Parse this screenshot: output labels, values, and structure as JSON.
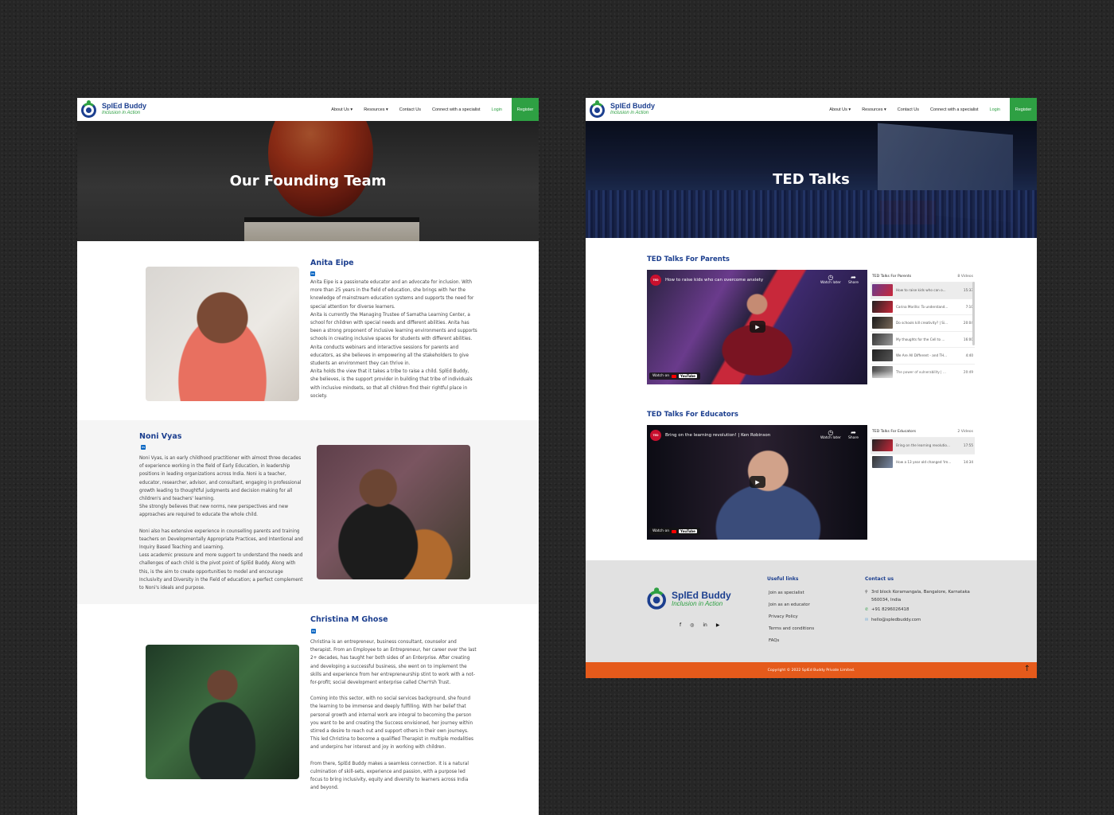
{
  "brand": {
    "name": "SplEd Buddy",
    "tagline": "Inclusion in Action"
  },
  "nav": {
    "about": "About Us ▾",
    "resources": "Resources ▾",
    "contact": "Contact Us",
    "connect": "Connect with a specialist",
    "login": "Login",
    "register": "Register"
  },
  "team_page": {
    "hero_title": "Our Founding Team",
    "members": [
      {
        "name": "Anita Eipe",
        "paragraphs": [
          "Anita Eipe is a passionate educator and an advocate for inclusion. With more than 25 years in the field of education, she brings with her the knowledge of mainstream education systems and supports the need for special attention for diverse learners.",
          "Anita is currently the Managing Trustee of Samatha Learning Center, a school for children with special needs and different abilities. Anita has been a strong proponent of inclusive learning environments and supports schools in creating inclusive spaces for students with different abilities. Anita conducts webinars and interactive sessions for parents and educators, as she believes in empowering all the stakeholders to give students an environment they can thrive in.",
          "Anita holds the view that it takes a tribe to raise a child. SplEd Buddy, she believes, is the support provider in building that tribe of individuals with inclusive mindsets, so that all children find their rightful place in society."
        ]
      },
      {
        "name": "Noni Vyas",
        "paragraphs": [
          "Noni Vyas, is an early childhood practitioner with almost three decades of experience working in the field of Early Education, in leadership positions in leading organizations across India. Noni is a teacher, educator, researcher, advisor, and consultant, engaging in professional growth leading to thoughtful judgments and decision making for all children's and teachers' learning.",
          "She strongly believes that new norms, new perspectives and new approaches are required to educate the whole child.",
          "Noni also has extensive experience in counselling parents and training teachers on Developmentally Appropriate Practices, and Intentional and Inquiry Based Teaching and Learning.",
          "Less academic pressure and more support to understand the needs and challenges of each child is the pivot point of SplEd Buddy. Along with this, is the aim to create opportunities to model and encourage Inclusivity and Diversity in the Field of education; a perfect complement to Noni's ideals and purpose."
        ]
      },
      {
        "name": "Christina M Ghose",
        "paragraphs": [
          "Christina is an entrepreneur, business consultant, counselor and therapist. From an Employee to an Entrepreneur, her career over the last 2+ decades, has taught her both sides of an Enterprise. After creating and developing a successful business, she went on to implement the skills and experience from her entrepreneurship stint to work with a not-for-profit; social development enterprise called CherYsh Trust.",
          "Coming into this sector, with no social services background, she found the learning to be immense and deeply fulfilling. With her belief that personal growth and internal work are integral to becoming the person you want to be and creating the Success envisioned, her journey within stirred a desire to reach out and support others in their own journeys. This led Christina to become a qualified Therapist in multiple modalities and underpins her interest and joy in working with children.",
          "From there, SplEd Buddy makes a seamless connection. It is a natural culmination of skill-sets, experience and passion, with a purpose led focus to bring inclusivity, equity and diversity to learners across India and beyond."
        ]
      }
    ]
  },
  "ted_page": {
    "hero_title": "TED Talks",
    "sections": [
      {
        "title": "TED Talks For Parents",
        "video_title": "How to raise kids who can overcome anxiety",
        "watch_later": "Watch later",
        "share": "Share",
        "watch_on": "Watch on",
        "youtube": "YouTube",
        "playlist_title": "TED Talks For Parents",
        "playlist_count": "8 Videos",
        "items": [
          {
            "title": "How to raise kids who can o...",
            "duration": "15:33"
          },
          {
            "title": "Carina Morillo: To understand...",
            "duration": "7:10"
          },
          {
            "title": "Do schools kill creativity? | Si...",
            "duration": "20:04"
          },
          {
            "title": "My thoughts for the Cell to ...",
            "duration": "16:00"
          },
          {
            "title": "We Are All Different - and TH...",
            "duration": "4:40"
          },
          {
            "title": "The power of vulnerability | ...",
            "duration": "20:49"
          }
        ]
      },
      {
        "title": "TED Talks For Educators",
        "video_title": "Bring on the learning revolution! | Ken Robinson",
        "watch_later": "Watch later",
        "share": "Share",
        "watch_on": "Watch on",
        "youtube": "YouTube",
        "playlist_title": "TED Talks For Educators",
        "playlist_count": "2 Videos",
        "items": [
          {
            "title": "Bring on the learning revolutio...",
            "duration": "17:55"
          },
          {
            "title": "How a 13 year old changed 'Im...",
            "duration": "14:34"
          }
        ]
      }
    ],
    "footer": {
      "useful_links_title": "Useful links",
      "links": [
        "Join as specialist",
        "Join as an educator",
        "Privacy Policy",
        "Terms and conditions",
        "FAQs"
      ],
      "contact_title": "Contact us",
      "address": "3rd block Koramangala, Bangalore, Karnataka 560034, India",
      "phone": "+91 8296026418",
      "email": "hello@spledbuddy.com",
      "social": [
        "f",
        "◎",
        "in",
        "▶"
      ],
      "copyright": "Copyright © 2022  SplEd Buddy Private Limited."
    }
  },
  "colors": {
    "brand_blue": "#1c3f8f",
    "brand_green": "#2ea043",
    "footer_orange": "#e55a1b"
  }
}
